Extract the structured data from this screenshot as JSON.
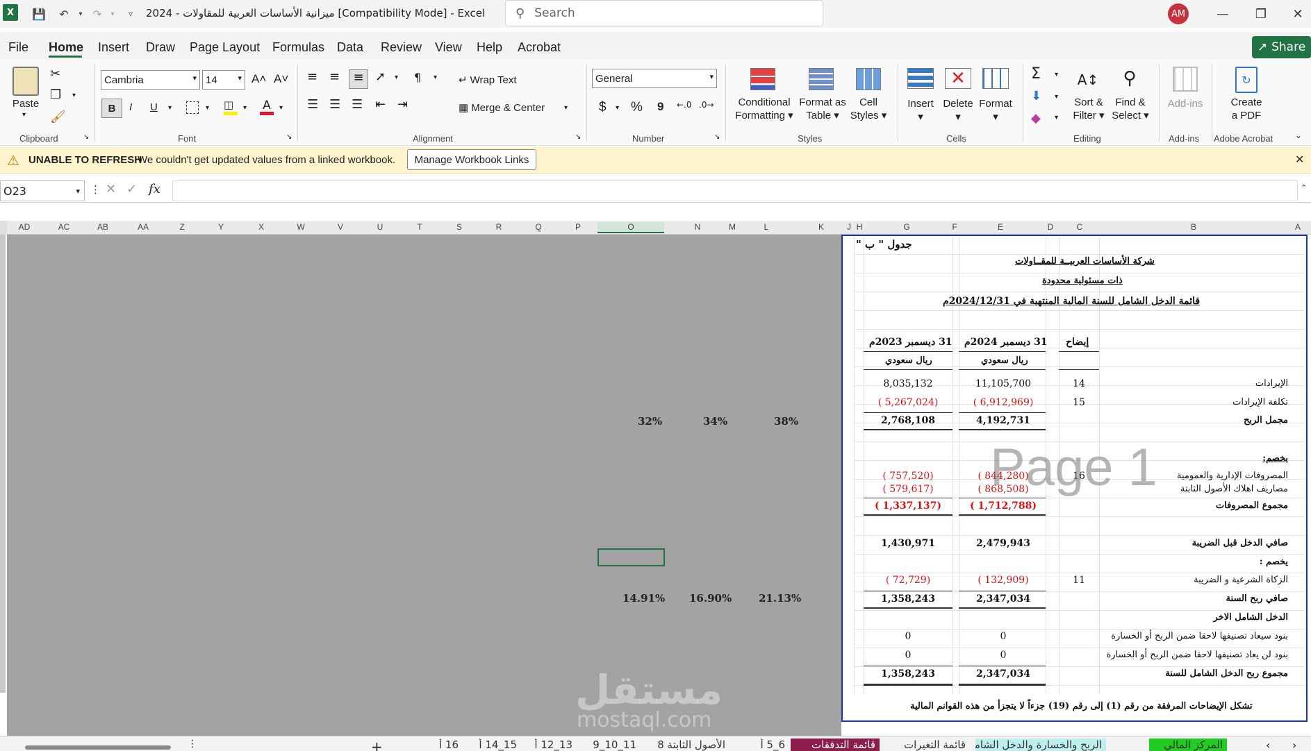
{
  "titlebar": {
    "title": "ميزانية الأساسات العربية للمقاولات - 2024  [Compatibility Mode]  -  Excel",
    "search_placeholder": "Search",
    "avatar_initials": "AM"
  },
  "menu": [
    "File",
    "Home",
    "Insert",
    "Draw",
    "Page Layout",
    "Formulas",
    "Data",
    "Review",
    "View",
    "Help",
    "Acrobat"
  ],
  "share_label": "Share",
  "ribbon": {
    "clipboard": {
      "paste": "Paste",
      "group": "Clipboard"
    },
    "font": {
      "name": "Cambria",
      "size": "14",
      "group": "Font",
      "bold": "B",
      "italic": "I",
      "underline": "U",
      "grow": "A˄",
      "shrink": "A˅"
    },
    "alignment": {
      "wrap": "Wrap Text",
      "merge": "Merge & Center",
      "group": "Alignment"
    },
    "number": {
      "format": "General",
      "group": "Number",
      "currency": "$",
      "percent": "%",
      "comma": "9"
    },
    "styles": {
      "cond1": "Conditional",
      "cond2": "Formatting",
      "fmt1": "Format as",
      "fmt2": "Table",
      "cell1": "Cell",
      "cell2": "Styles",
      "group": "Styles"
    },
    "cells": {
      "insert": "Insert",
      "delete": "Delete",
      "format": "Format",
      "group": "Cells"
    },
    "editing": {
      "sort1": "Sort &",
      "sort2": "Filter",
      "find1": "Find &",
      "find2": "Select",
      "group": "Editing"
    },
    "addins": {
      "label": "Add-ins",
      "group": "Add-ins"
    },
    "acrobat": {
      "l1": "Create",
      "l2": "a PDF",
      "group": "Adobe Acrobat"
    }
  },
  "message": {
    "title": "UNABLE TO REFRESH",
    "text": "We couldn't get updated values from a linked workbook.",
    "button": "Manage Workbook Links"
  },
  "namebox": "O23",
  "formula_fx": "fx",
  "columns": [
    "AD",
    "AC",
    "AB",
    "AA",
    "Z",
    "Y",
    "X",
    "W",
    "V",
    "U",
    "T",
    "S",
    "R",
    "Q",
    "P",
    "O",
    "N",
    "M",
    "L",
    "K",
    "J",
    "H",
    "G",
    "F",
    "E",
    "D",
    "C",
    "B",
    "A"
  ],
  "grey_values": {
    "r1": [
      "32%",
      "34%",
      "38%"
    ],
    "r2": [
      "14.91%",
      "16.90%",
      "21.13%"
    ]
  },
  "statement": {
    "table_tag": "جدول \" ب \"",
    "company": "شركة الأساسات العربيــة للمقــاولات",
    "entity": "ذات مسئولية محدودة",
    "title": "قائمة الدخل الشامل للسنة المالية المنتهية في 2024/12/31م",
    "col_note": "إيضاح",
    "col_2024": "31 ديسمبر 2024م",
    "col_2023": "31 ديسمبر 2023م",
    "currency": "ريال سعودي",
    "rows": [
      {
        "label": "الإيرادات",
        "note": "14",
        "v2024": "11,105,700",
        "v2023": "8,035,132"
      },
      {
        "label": "تكلفة الإيرادات",
        "note": "15",
        "v2024": "( 6,912,969)",
        "v2023": "( 5,267,024)"
      },
      {
        "label": "مجمل الربح",
        "note": "",
        "v2024": "4,192,731",
        "v2023": "2,768,108"
      },
      {
        "label": "يخصم:",
        "note": "",
        "v2024": "",
        "v2023": ""
      },
      {
        "label": "المصروفات الإدارية والعمومية",
        "note": "16",
        "v2024": "( 844,280)",
        "v2023": "( 757,520)"
      },
      {
        "label": "مصاريف اهلاك الأصول الثابتة",
        "note": "",
        "v2024": "( 868,508)",
        "v2023": "( 579,617)"
      },
      {
        "label": "مجموع المصروفات",
        "note": "",
        "v2024": "( 1,712,788)",
        "v2023": "( 1,337,137)"
      },
      {
        "label": "صافي الدخل قبل الضريبة",
        "note": "",
        "v2024": "2,479,943",
        "v2023": "1,430,971"
      },
      {
        "label": "يخصم :",
        "note": "",
        "v2024": "",
        "v2023": ""
      },
      {
        "label": "الزكاة الشرعية و الضريبة",
        "note": "11",
        "v2024": "( 132,909)",
        "v2023": "( 72,729)"
      },
      {
        "label": "صافي ربح السنة",
        "note": "",
        "v2024": "2,347,034",
        "v2023": "1,358,243"
      },
      {
        "label": "الدخل الشامل الاخر",
        "note": "",
        "v2024": "",
        "v2023": ""
      },
      {
        "label": "بنود سيعاد تصنيفها لاحقا ضمن الربح أو الخسارة",
        "note": "",
        "v2024": "0",
        "v2023": "0"
      },
      {
        "label": "بنود لن يعاد تصنيفها لاحقا ضمن الربح أو الخسارة",
        "note": "",
        "v2024": "0",
        "v2023": "0"
      },
      {
        "label": "مجموع ربح الدخل الشامل للسنة",
        "note": "",
        "v2024": "2,347,034",
        "v2023": "1,358,243"
      }
    ],
    "footer": "تشكل الإيضاحات المرفقة من رقم (1) إلى رقم (19) جزءاً لا يتجزأ من هذه القوانم المالية",
    "watermark": "Page 1"
  },
  "tabs": [
    "16 أ",
    "15_14 أ",
    "13_12 أ",
    "11_10_9",
    "الأصول الثابتة 8",
    "6_5 أ",
    "قائمة التدفقات",
    "قائمة التغيرات",
    "الربح والخسارة والدخل الشامل",
    "المركز المالي"
  ],
  "brand_watermark": {
    "ar": "مستقل",
    "en": "mostaql.com"
  }
}
